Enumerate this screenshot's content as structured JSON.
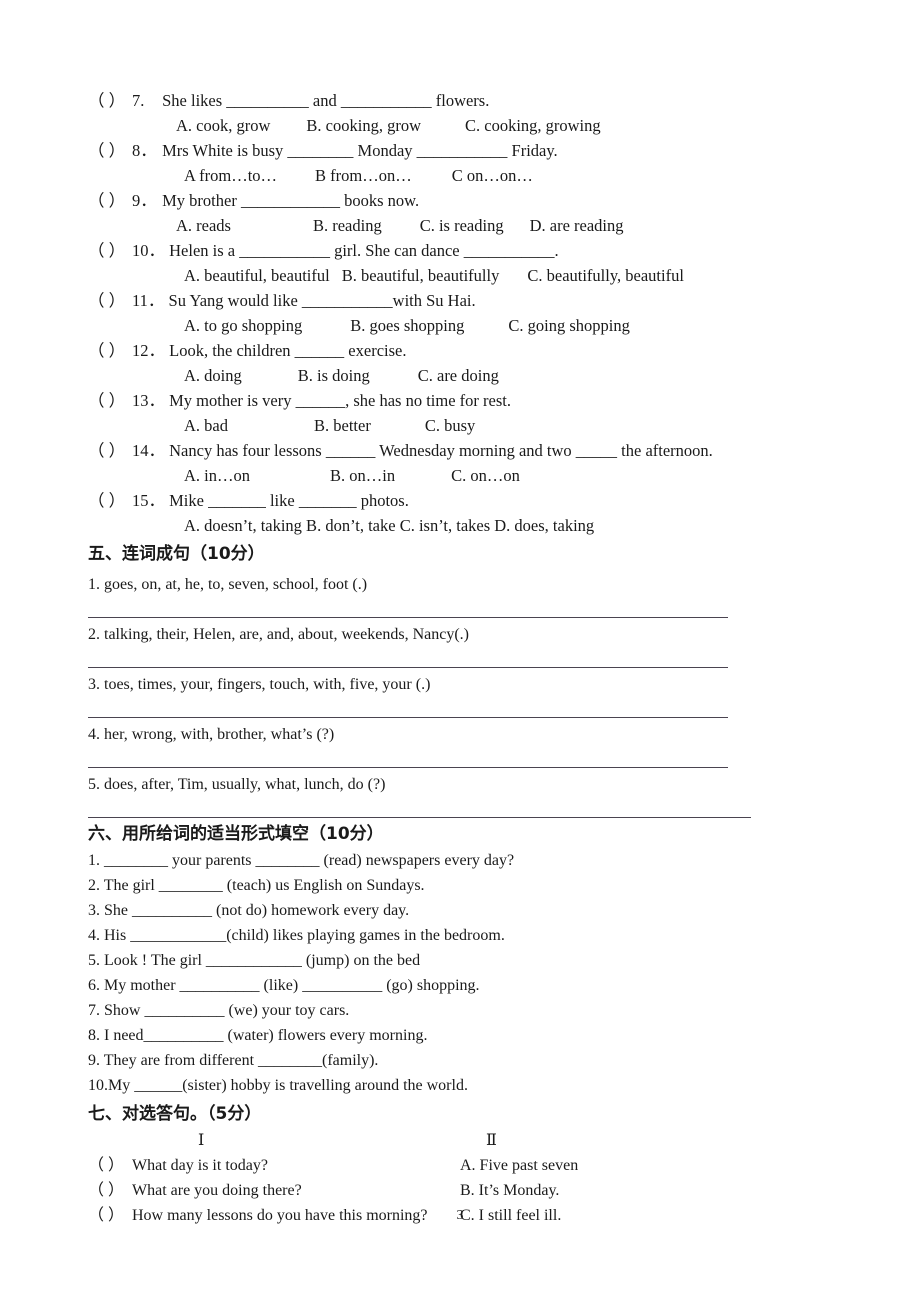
{
  "page": {
    "number": "3"
  },
  "multiple_choice": {
    "items": [
      {
        "paren": "（    ）",
        "number": "7.",
        "stem": "She likes  __________  and  ___________  flowers.",
        "options": [
          {
            "text": "A. cook, grow",
            "gap": 0
          },
          {
            "text": "B. cooking, grow",
            "gap": 36
          },
          {
            "text": "C. cooking, growing",
            "gap": 44
          }
        ],
        "options_indent": 88
      },
      {
        "paren": "（    ）",
        "number": "8．",
        "stem": "Mrs White is busy ________ Monday ___________ Friday.",
        "options": [
          {
            "text": "A from…to…",
            "gap": 0
          },
          {
            "text": "B from…on…",
            "gap": 38
          },
          {
            "text": "C on…on…",
            "gap": 40
          }
        ],
        "options_indent": 96
      },
      {
        "paren": "（    ）",
        "number": "9．",
        "stem": "My brother ____________ books now.",
        "options": [
          {
            "text": "A. reads",
            "gap": 0
          },
          {
            "text": "B. reading",
            "gap": 82
          },
          {
            "text": "C. is reading",
            "gap": 38
          },
          {
            "text": "D. are reading",
            "gap": 26
          }
        ],
        "options_indent": 88
      },
      {
        "paren": "（    ）",
        "number": "10．",
        "stem": "Helen is a ___________ girl. She can dance ___________.",
        "options": [
          {
            "text": "A. beautiful, beautiful",
            "gap": 0
          },
          {
            "text": "B. beautiful, beautifully",
            "gap": 12
          },
          {
            "text": "C. beautifully, beautiful",
            "gap": 28
          }
        ],
        "options_indent": 96
      },
      {
        "paren": "（    ）",
        "number": "11．",
        "stem": "Su Yang would like ___________with Su Hai.",
        "options": [
          {
            "text": "A. to go shopping",
            "gap": 0
          },
          {
            "text": "B. goes shopping",
            "gap": 48
          },
          {
            "text": "C. going shopping",
            "gap": 44
          }
        ],
        "options_indent": 96
      },
      {
        "paren": "（    ）",
        "number": "12．",
        "stem": "Look, the children ______ exercise.",
        "options": [
          {
            "text": "A. doing",
            "gap": 0
          },
          {
            "text": "B. is doing",
            "gap": 56
          },
          {
            "text": "C. are doing",
            "gap": 48
          }
        ],
        "options_indent": 96
      },
      {
        "paren": "（    ）",
        "number": "13．",
        "stem": "My mother is very ______, she has no time for rest.",
        "options": [
          {
            "text": "A. bad",
            "gap": 0
          },
          {
            "text": "B. better",
            "gap": 86
          },
          {
            "text": "C. busy",
            "gap": 54
          }
        ],
        "options_indent": 96
      },
      {
        "paren": "（    ）",
        "number": "14．",
        "stem": "Nancy has four lessons ______ Wednesday morning and two _____ the afternoon.",
        "options": [
          {
            "text": "A. in…on",
            "gap": 0
          },
          {
            "text": "B. on…in",
            "gap": 80
          },
          {
            "text": "C. on…on",
            "gap": 56
          }
        ],
        "options_indent": 96
      },
      {
        "paren": "（    ）",
        "number": "15．",
        "stem": "Mike _______ like _______ photos.",
        "options": [
          {
            "text": "A. doesn’t, taking B. don’t, take C. isn’t, takes D. does, taking",
            "gap": 0
          }
        ],
        "options_indent": 96
      }
    ]
  },
  "section_five": {
    "heading": "五、连词成句（10分）",
    "items": [
      "1. goes, on, at, he, to, seven, school, foot (.)",
      "2. talking, their, Helen, are, and, about, weekends, Nancy(.)",
      "3. toes, times, your, fingers, touch, with, five, your (.)",
      "4. her, wrong, with, brother, what’s (?)",
      "5. does, after, Tim, usually, what, lunch, do (?)"
    ]
  },
  "section_six": {
    "heading": "六、用所给词的适当形式填空（10分）",
    "items": [
      "1. ________  your parents  ________  (read) newspapers every day?",
      "2. The girl  ________  (teach) us English on Sundays.",
      "3. She  __________  (not do) homework every day.",
      "4. His ____________(child) likes playing games in the bedroom.",
      "5. Look !  The girl ____________  (jump) on the bed",
      "6. My mother  __________  (like)  __________  (go) shopping.",
      "7. Show  __________  (we) your toy cars.",
      "8. I need__________ (water) flowers every morning.",
      "9. They are from different ________(family).",
      "10.My ______(sister) hobby is travelling around the world."
    ]
  },
  "section_seven": {
    "heading": "七、对选答句。（5分）",
    "col1_header": "Ⅰ",
    "col2_header": "Ⅱ",
    "rows": [
      {
        "paren": "（      ）",
        "question": "What day is it today?",
        "answer": "A. Five past seven"
      },
      {
        "paren": "（      ）",
        "question": "What are you doing there?",
        "answer": "B. It’s Monday."
      },
      {
        "paren": "（      ）",
        "question": "How many lessons do you have this morning?",
        "answer": "C. I still feel ill."
      }
    ]
  }
}
